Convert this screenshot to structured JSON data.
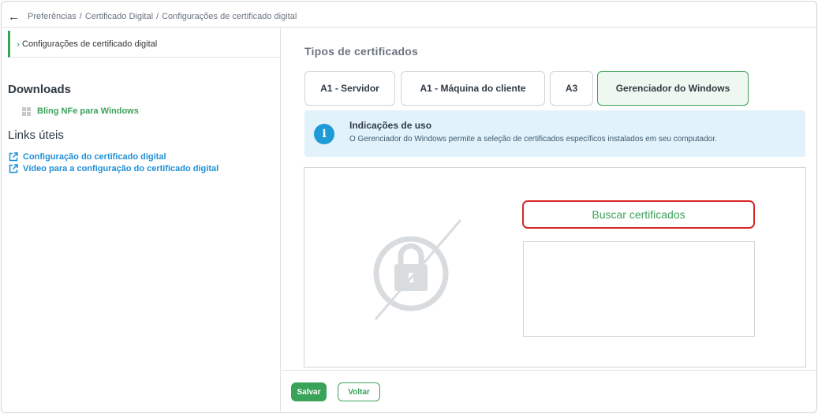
{
  "breadcrumb": {
    "items": [
      "Preferências",
      "Certificado Digital",
      "Configurações de certificado digital"
    ],
    "separator": "/"
  },
  "sidebar": {
    "section_label": "Configurações de certificado digital",
    "downloads_title": "Downloads",
    "downloads": [
      {
        "label": "Bling NFe para Windows",
        "icon": "windows-icon"
      }
    ],
    "links_title": "Links úteis",
    "links": [
      {
        "label": "Configuração do certificado digital",
        "icon": "external-link-icon"
      },
      {
        "label": "Vídeo para a configuração do certificado digital",
        "icon": "external-link-icon"
      }
    ]
  },
  "main": {
    "types_title": "Tipos de certificados",
    "tabs": [
      {
        "label": "A1 - Servidor",
        "active": false
      },
      {
        "label": "A1 - Máquina do cliente",
        "active": false
      },
      {
        "label": "A3",
        "active": false
      },
      {
        "label": "Gerenciador do Windows",
        "active": true
      }
    ],
    "info": {
      "title": "Indicações de uso",
      "text": "O Gerenciador do Windows permite a seleção de certificados específicos instalados em seu computador.",
      "icon": "info-icon"
    },
    "search_button": "Buscar certificados",
    "placeholder_icon": "no-certificate-lock-icon"
  },
  "footer": {
    "save_label": "Salvar",
    "back_label": "Voltar"
  },
  "colors": {
    "accent_green": "#3aa35a",
    "link_blue": "#1e8fd6",
    "info_bg": "#e1f2fb",
    "alert_red": "#d62828"
  }
}
